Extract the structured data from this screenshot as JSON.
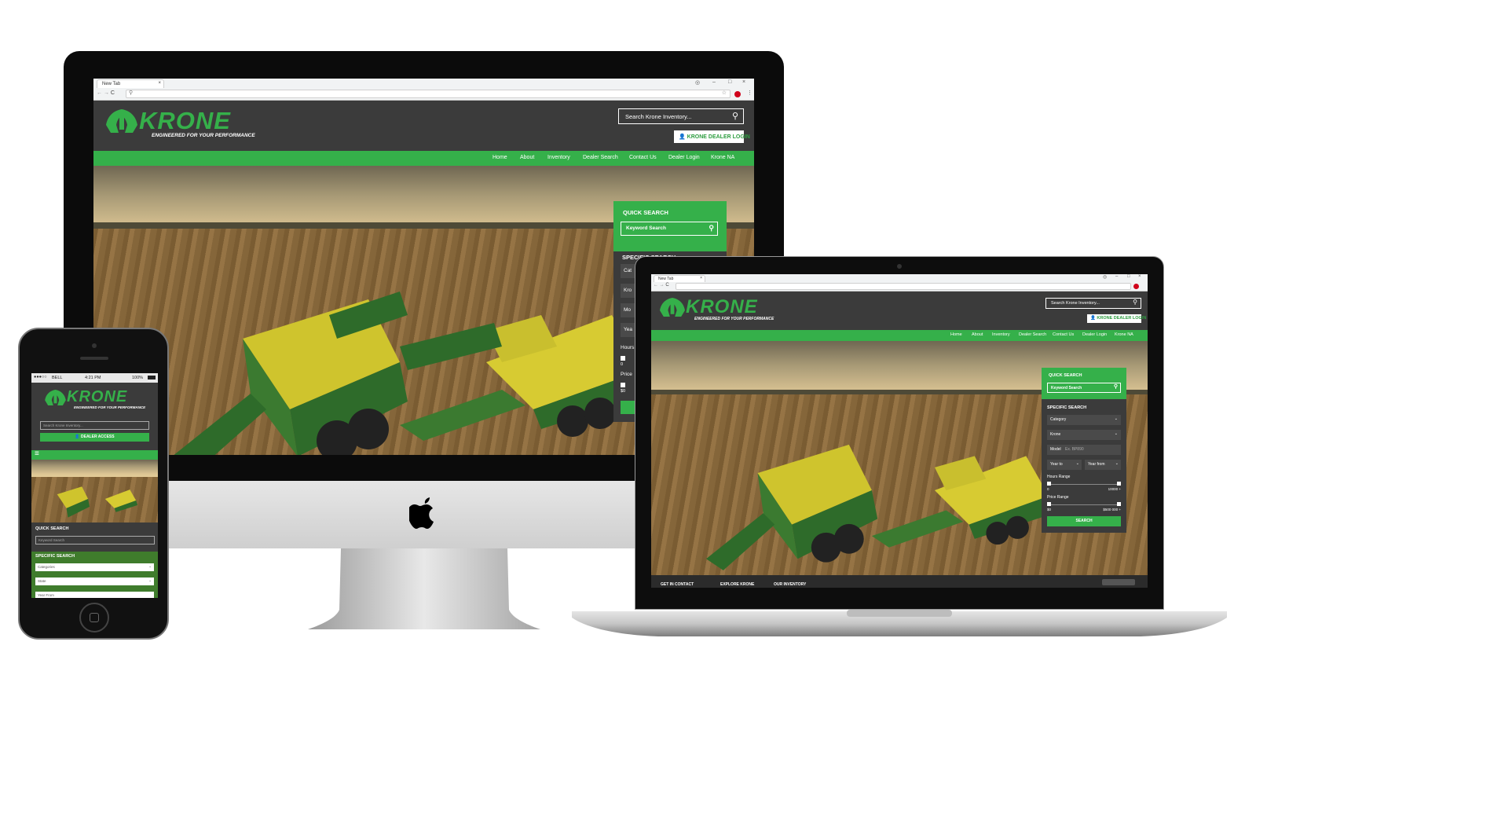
{
  "browser": {
    "tab_title": "New Tab",
    "address_value": ""
  },
  "site": {
    "logo_text": "KRONE",
    "tagline": "ENGINEERED FOR YOUR PERFORMANCE",
    "search_placeholder": "Search Krone Inventory...",
    "dealer_login": "KRONE DEALER LOGIN",
    "dealer_access": "DEALER ACCESS",
    "nav": [
      "Home",
      "About",
      "Inventory",
      "Dealer Search",
      "Contact Us",
      "Dealer Login",
      "Krone NA"
    ],
    "quick_search": "QUICK SEARCH",
    "keyword_search": "Keyword Search",
    "specific_search": "SPECIFIC SEARCH",
    "fields": {
      "category": "Category",
      "brand": "Krone",
      "model": "Model",
      "model_hint": "Ex. BP890",
      "year_to": "Year to",
      "year_from": "Year from",
      "hours_range": "Hours Range",
      "hours_min": "0",
      "hours_max": "10000 +",
      "price_range": "Price Range",
      "price_min": "$0",
      "price_max": "$500 000 +",
      "search_btn": "SEARCH"
    },
    "desktop_partial": {
      "cat": "Cat",
      "kro": "Kro",
      "mo": "Mo",
      "yea": "Yea",
      "hours": "Hours",
      "zero": "0",
      "price": "Price",
      "dollar0": "$0"
    },
    "footer": [
      "GET IN CONTACT",
      "EXPLORE KRONE",
      "OUR INVENTORY"
    ],
    "mobile": {
      "carrier": "BELL",
      "time": "4:21 PM",
      "battery": "100%",
      "keyword_placeholder": "Keyword Search",
      "categories": "Categories",
      "state": "State",
      "year_from": "Year From"
    }
  },
  "colors": {
    "green": "#35b04a",
    "dark": "#3b3b3b"
  }
}
